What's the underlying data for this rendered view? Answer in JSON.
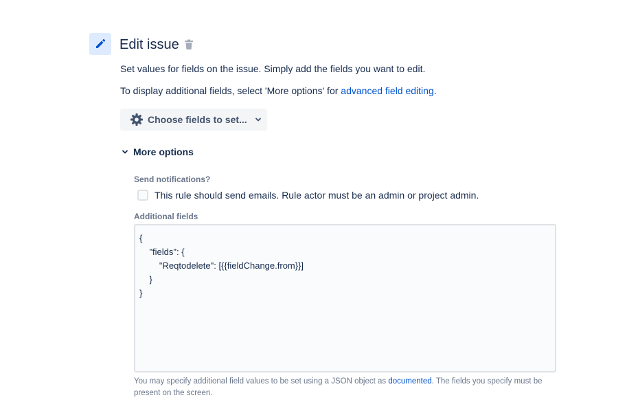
{
  "header": {
    "title": "Edit issue",
    "icon": "pencil-icon",
    "accent_color": "#0052cc",
    "icon_bg": "#deebff"
  },
  "description": {
    "line1": "Set values for fields on the issue. Simply add the fields you want to edit.",
    "line2_prefix": "To display additional fields, select 'More options' for ",
    "line2_link": "advanced field editing",
    "line2_suffix": "."
  },
  "choose_fields": {
    "label": "Choose fields to set..."
  },
  "more_options": {
    "label": "More options",
    "expanded": true
  },
  "notifications": {
    "label": "Send notifications?",
    "checkbox_label": "This rule should send emails. Rule actor must be an admin or project admin.",
    "checked": false
  },
  "additional_fields": {
    "label": "Additional fields",
    "value": "{\n    \"fields\": {\n        \"Reqtodelete\": [{{fieldChange.from}}]\n    }\n}"
  },
  "help": {
    "prefix": "You may specify additional field values to be set using a JSON object as ",
    "link": "documented",
    "suffix": ". The fields you specify must be present on the screen."
  }
}
